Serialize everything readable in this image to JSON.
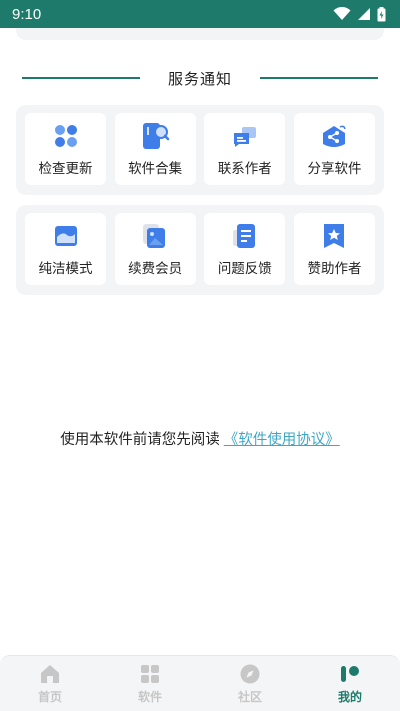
{
  "status_bar": {
    "time": "9:10"
  },
  "section": {
    "title": "服务通知"
  },
  "colors": {
    "accent": "#1e7a6b",
    "icon_blue": "#3f7de8",
    "link": "#3fa7c6"
  },
  "grid_row1": [
    {
      "label": "检查更新",
      "icon": "apps-icon"
    },
    {
      "label": "软件合集",
      "icon": "phone-search-icon"
    },
    {
      "label": "联系作者",
      "icon": "chat-icon"
    },
    {
      "label": "分享软件",
      "icon": "share-icon"
    }
  ],
  "grid_row2": [
    {
      "label": "纯洁模式",
      "icon": "window-icon"
    },
    {
      "label": "续费会员",
      "icon": "photo-icon"
    },
    {
      "label": "问题反馈",
      "icon": "document-icon"
    },
    {
      "label": "赞助作者",
      "icon": "star-badge-icon"
    }
  ],
  "agreement": {
    "text": "使用本软件前请您先阅读",
    "link": "《软件使用协议》"
  },
  "bottom_nav": [
    {
      "label": "首页",
      "icon": "home-icon",
      "active": false
    },
    {
      "label": "软件",
      "icon": "grid-icon",
      "active": false
    },
    {
      "label": "社区",
      "icon": "compass-icon",
      "active": false
    },
    {
      "label": "我的",
      "icon": "profile-icon",
      "active": true
    }
  ]
}
